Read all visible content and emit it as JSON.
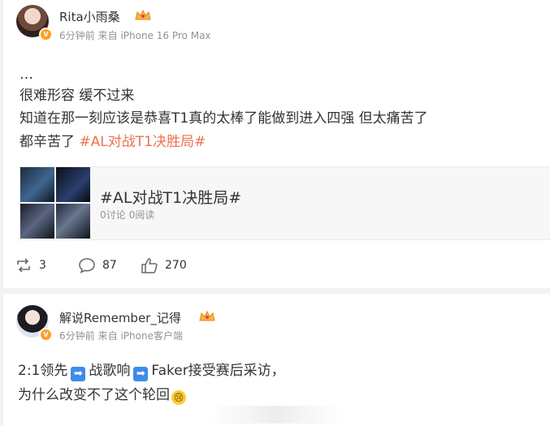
{
  "post1": {
    "author": "Rita小雨桑",
    "time": "6分钟前",
    "source": "来自 iPhone 16 Pro Max",
    "lines": [
      "…",
      "很难形容 缓不过来",
      "知道在那一刻应该是恭喜T1真的太棒了能做到进入四强 但太痛苦了",
      "都辛苦了"
    ],
    "topic_inline": "#AL对战T1决胜局#",
    "card": {
      "title": "#AL对战T1决胜局#",
      "discuss": "0讨论",
      "reads": "0阅读"
    },
    "actions": {
      "reposts": "3",
      "comments": "87",
      "likes": "270"
    }
  },
  "post2": {
    "author": "解说Remember_记得",
    "time": "6分钟前",
    "source": "来自 iPhone客户端",
    "line1": {
      "a": "2:1领先",
      "b": "战歌响",
      "c": "Faker接受赛后采访，"
    },
    "line2": "为什么改变不了这个轮回"
  },
  "colors": {
    "accent": "#eb7350",
    "verified": "#fe9f22",
    "arrow": "#3d8ce8"
  },
  "icons": [
    "repost-icon",
    "comment-icon",
    "like-icon",
    "crown-icon",
    "arrow-right-icon",
    "crying-emoji-icon"
  ]
}
